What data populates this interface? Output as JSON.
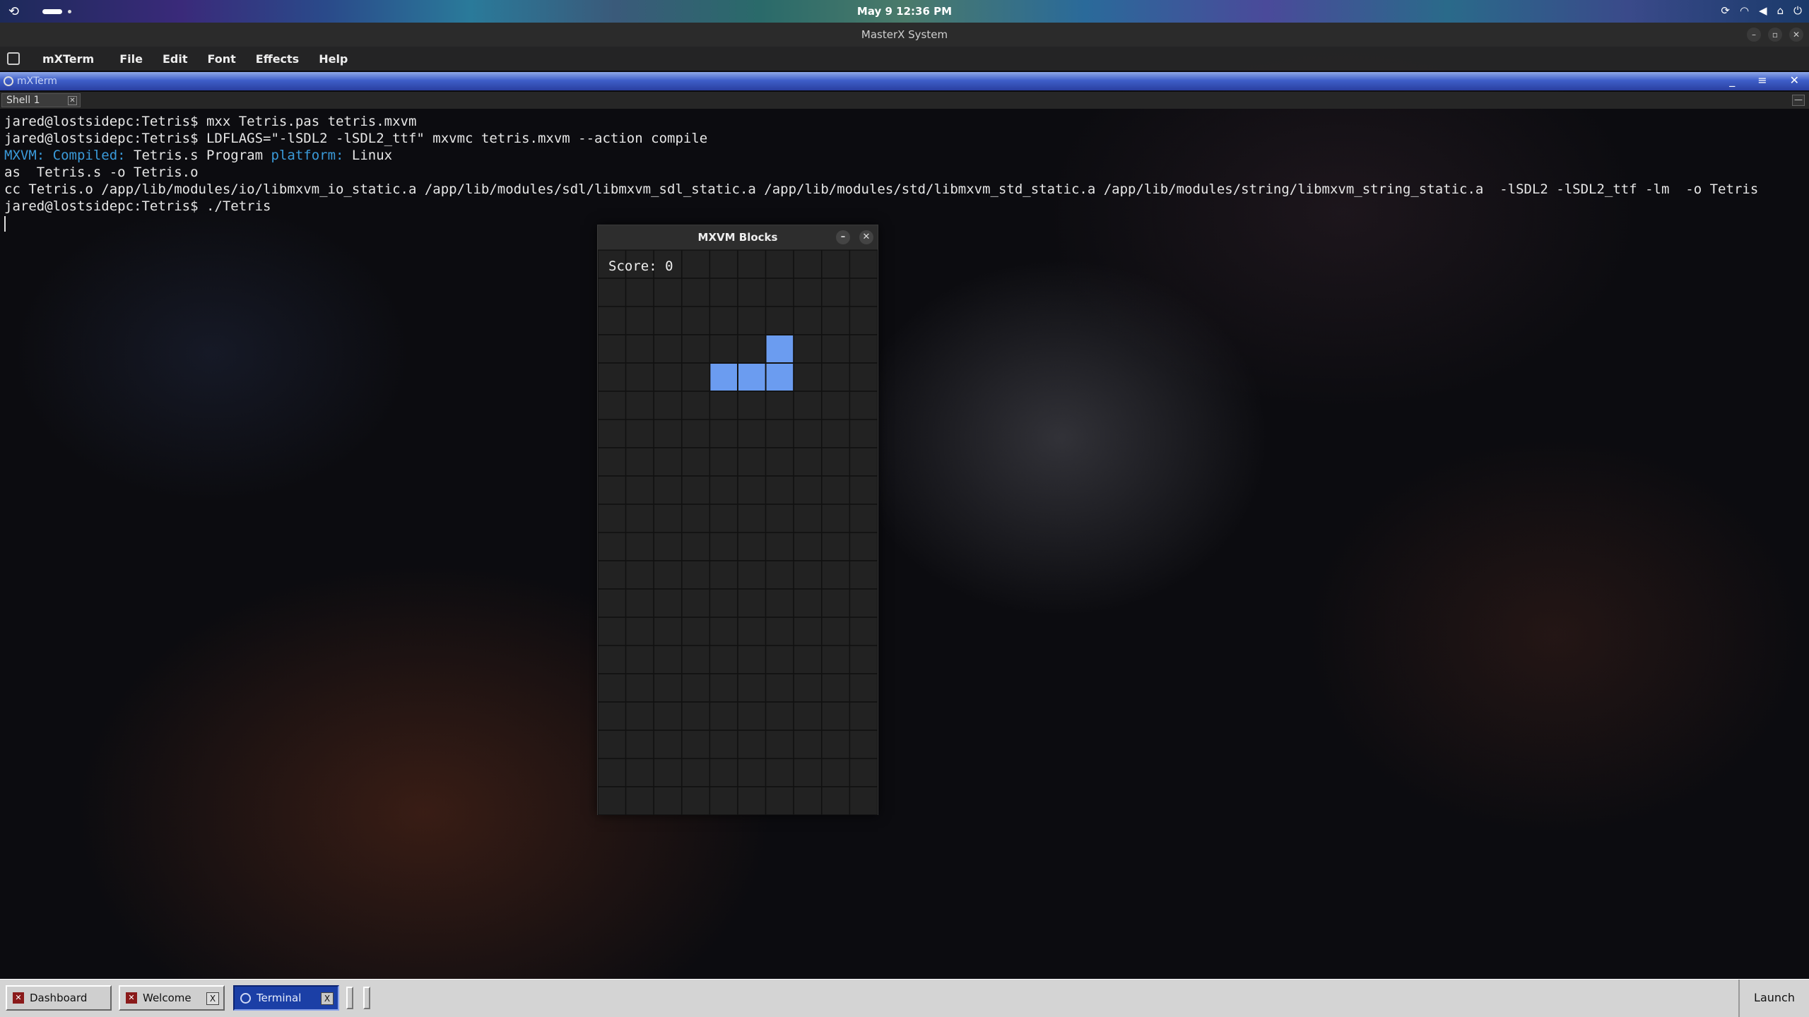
{
  "top_bar": {
    "clock": "May 9  12:36 PM"
  },
  "system_window": {
    "title": "MasterX System"
  },
  "menu": {
    "app_name": "mXTerm",
    "items": [
      "File",
      "Edit",
      "Font",
      "Effects",
      "Help"
    ]
  },
  "terminal_window": {
    "title": "mXTerm",
    "tab_label": "Shell 1",
    "lines": [
      {
        "prompt": "jared@lostsidepc:Tetris$ ",
        "text": "mxx Tetris.pas tetris.mxvm"
      },
      {
        "prompt": "jared@lostsidepc:Tetris$ ",
        "text": "LDFLAGS=\"-lSDL2 -lSDL2_ttf\" mxvmc tetris.mxvm --action compile"
      },
      {
        "mxvm_label": "MXVM: ",
        "compiled_label": "Compiled: ",
        "compiled_text": "Tetris.s Program ",
        "platform_label": "platform: ",
        "platform_value": "Linux"
      },
      {
        "text": "as  Tetris.s -o Tetris.o"
      },
      {
        "text": "cc Tetris.o /app/lib/modules/io/libmxvm_io_static.a /app/lib/modules/sdl/libmxvm_sdl_static.a /app/lib/modules/std/libmxvm_std_static.a /app/lib/modules/string/libmxvm_string_static.a  -lSDL2 -lSDL2_ttf -lm  -o Tetris"
      },
      {
        "prompt": "jared@lostsidepc:Tetris$ ",
        "text": "./Tetris"
      }
    ]
  },
  "game": {
    "title": "MXVM Blocks",
    "score_text": "Score: 0",
    "grid": {
      "cols": 10,
      "rows": 20
    },
    "piece_color": "#6b9cf0",
    "filled_cells": [
      [
        6,
        3
      ],
      [
        4,
        4
      ],
      [
        5,
        4
      ],
      [
        6,
        4
      ]
    ]
  },
  "taskbar": {
    "buttons": [
      {
        "label": "Dashboard",
        "active": false
      },
      {
        "label": "Welcome",
        "active": false
      },
      {
        "label": "Terminal",
        "active": true
      }
    ],
    "close_glyph": "X",
    "launch_label": "Launch"
  }
}
